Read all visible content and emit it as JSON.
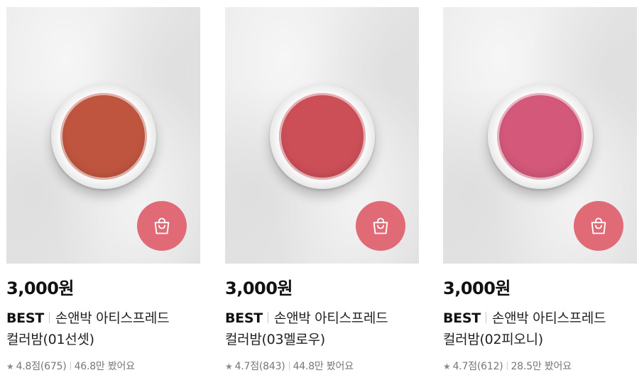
{
  "products": [
    {
      "price": "3,000원",
      "badge": "BEST",
      "name_line1": "손앤박 아티스프레드",
      "name_line2": "컬러밤(01선셋)",
      "star": "★",
      "rating": "4.8점(675)",
      "views": "46.8만 봤어요",
      "balm_color": "#c0553f",
      "cart_icon": "shopping-bag-icon"
    },
    {
      "price": "3,000원",
      "badge": "BEST",
      "name_line1": "손앤박 아티스프레드",
      "name_line2": "컬러밤(03멜로우)",
      "star": "★",
      "rating": "4.7점(843)",
      "views": "44.8만 봤어요",
      "balm_color": "#cc4f58",
      "cart_icon": "shopping-bag-icon"
    },
    {
      "price": "3,000원",
      "badge": "BEST",
      "name_line1": "손앤박 아티스프레드",
      "name_line2": "컬러밤(02피오니)",
      "star": "★",
      "rating": "4.7점(612)",
      "views": "28.5만 봤어요",
      "balm_color": "#d3587a",
      "cart_icon": "shopping-bag-icon"
    }
  ],
  "colors": {
    "cart_button": "#e06b76",
    "price_text": "#111111",
    "meta_text": "#777777"
  }
}
